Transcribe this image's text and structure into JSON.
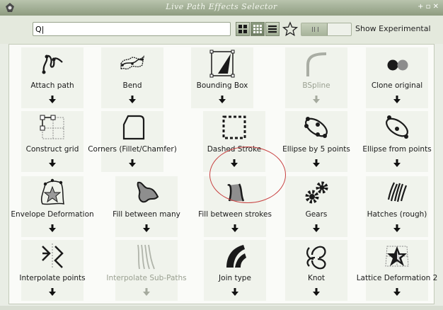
{
  "window": {
    "title": "Live Path Effects Selector",
    "controls": "+ ▫ ✕"
  },
  "search": {
    "value": "Q|",
    "placeholder": ""
  },
  "view_modes": [
    "grid-large-icon",
    "grid-small-icon",
    "list-icon"
  ],
  "favorites": {
    "icon": "star-icon"
  },
  "experimental": {
    "label": "Show Experimental",
    "enabled": false
  },
  "effects": [
    {
      "label": "Attach path",
      "enabled": true
    },
    {
      "label": "Bend",
      "enabled": true
    },
    {
      "label": "Bounding Box",
      "enabled": true
    },
    {
      "label": "BSpline",
      "enabled": false
    },
    {
      "label": "Clone original",
      "enabled": true
    },
    {
      "label": "Construct grid",
      "enabled": true
    },
    {
      "label": "Corners (Fillet/Chamfer)",
      "enabled": true
    },
    {
      "label": "Dashed Stroke",
      "enabled": true
    },
    {
      "label": "Ellipse by 5 points",
      "enabled": true
    },
    {
      "label": "Ellipse from points",
      "enabled": true
    },
    {
      "label": "Envelope Deformation",
      "enabled": true
    },
    {
      "label": "Fill between many",
      "enabled": true
    },
    {
      "label": "Fill between strokes",
      "enabled": true
    },
    {
      "label": "Gears",
      "enabled": true
    },
    {
      "label": "Hatches (rough)",
      "enabled": true
    },
    {
      "label": "Interpolate points",
      "enabled": true
    },
    {
      "label": "Interpolate Sub-Paths",
      "enabled": false
    },
    {
      "label": "Join type",
      "enabled": true
    },
    {
      "label": "Knot",
      "enabled": true
    },
    {
      "label": "Lattice Deformation 2",
      "enabled": true
    }
  ],
  "colors": {
    "accent": "#8e9c80",
    "highlight": "#c84040"
  }
}
